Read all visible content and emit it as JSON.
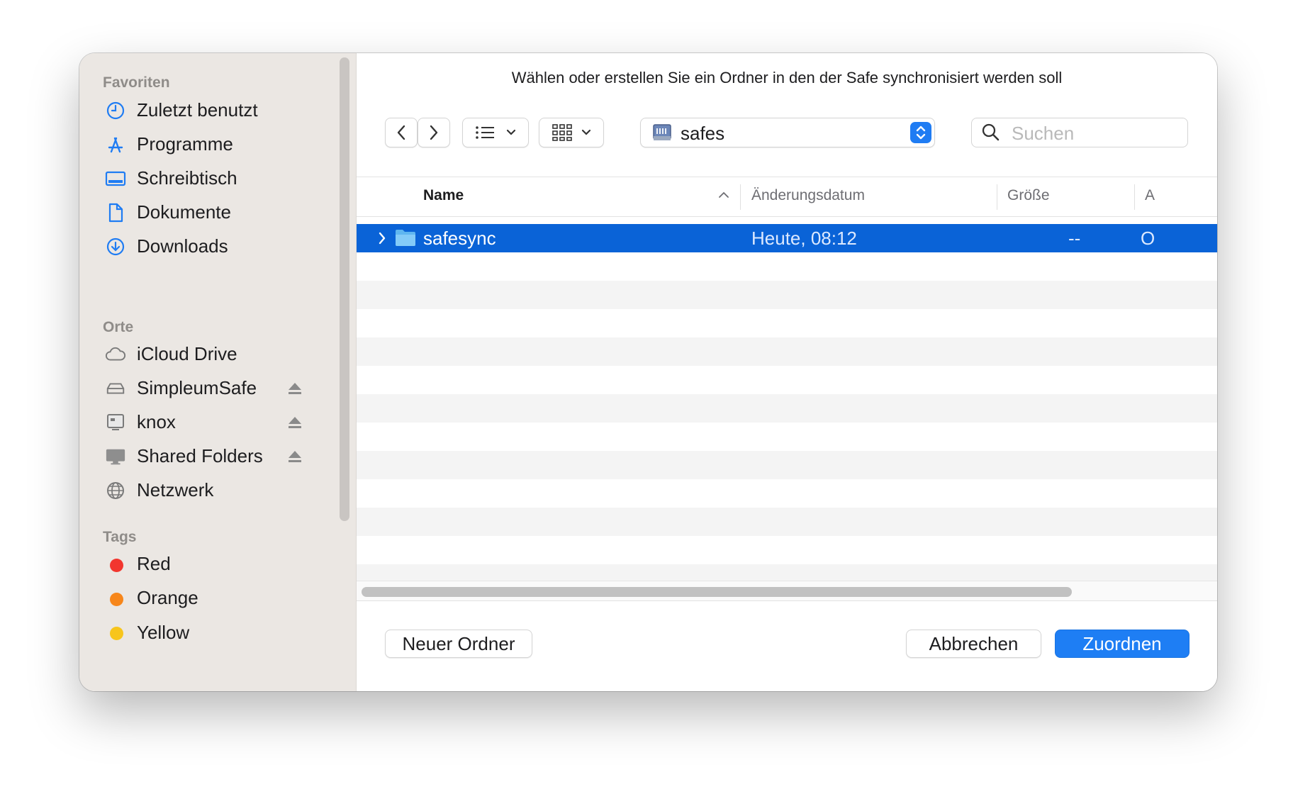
{
  "dialog": {
    "title": "Wählen oder erstellen Sie ein Ordner in den der Safe synchronisiert werden soll"
  },
  "sidebar": {
    "sections": {
      "favorites": "Favoriten",
      "locations": "Orte",
      "tags": "Tags"
    },
    "favorites": [
      {
        "label": "Zuletzt benutzt",
        "icon": "clock-icon"
      },
      {
        "label": "Programme",
        "icon": "applications-icon"
      },
      {
        "label": "Schreibtisch",
        "icon": "desktop-icon"
      },
      {
        "label": "Dokumente",
        "icon": "document-icon"
      },
      {
        "label": "Downloads",
        "icon": "download-icon"
      }
    ],
    "locations": [
      {
        "label": "iCloud Drive",
        "icon": "cloud-icon"
      },
      {
        "label": "SimpleumSafe",
        "icon": "drive-icon"
      },
      {
        "label": "knox",
        "icon": "server-icon"
      },
      {
        "label": "Shared Folders",
        "icon": "display-icon"
      },
      {
        "label": "Netzwerk",
        "icon": "globe-icon"
      }
    ],
    "tags": [
      {
        "label": "Red",
        "color": "#f2362e"
      },
      {
        "label": "Orange",
        "color": "#f7861a"
      },
      {
        "label": "Yellow",
        "color": "#f7c51c"
      }
    ]
  },
  "toolbar": {
    "path_label": "safes",
    "search_placeholder": "Suchen",
    "accent_color": "#1f7cf3"
  },
  "table": {
    "columns": {
      "name": "Name",
      "modified": "Änderungsdatum",
      "size": "Größe",
      "kind": "A"
    },
    "rows": [
      {
        "name": "safesync",
        "modified": "Heute, 08:12",
        "size": "--",
        "kind": "O",
        "selected": true
      }
    ]
  },
  "footer": {
    "new_folder": "Neuer Ordner",
    "cancel": "Abbrechen",
    "confirm": "Zuordnen"
  }
}
